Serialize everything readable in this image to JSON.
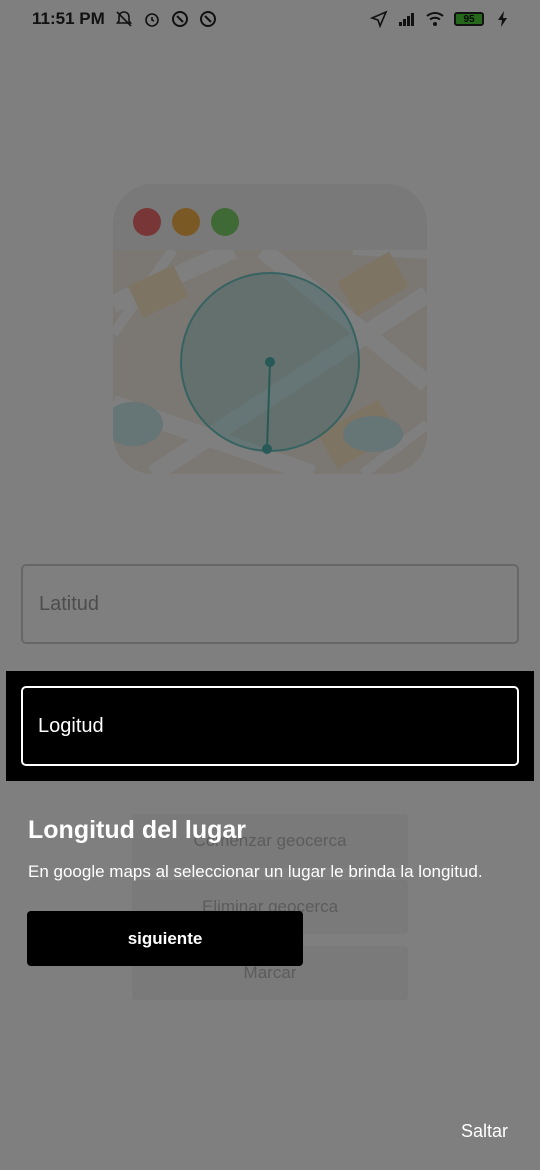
{
  "status_bar": {
    "time": "11:51 PM",
    "battery": "95",
    "icons": [
      "mute-bell-icon",
      "alarm-icon",
      "sync-icon",
      "sync-icon",
      "location-arrow-icon",
      "signal-icon",
      "wifi-icon",
      "battery-icon",
      "charging-icon"
    ]
  },
  "illustration": {
    "dot_colors": [
      "#f26d6d",
      "#f7b34b",
      "#7ed36b"
    ],
    "circle_color": "#6cc6c2"
  },
  "form": {
    "latitude_placeholder": "Latitud",
    "longitude_placeholder": "Logitud"
  },
  "buttons": {
    "start": "Comenzar geocerca",
    "delete": "Eliminar geocerca",
    "mark": "Marcar"
  },
  "tutorial": {
    "title": "Longitud del lugar",
    "description": "En google maps al seleccionar un lugar le brinda la longitud.",
    "next": "siguiente",
    "skip": "Saltar"
  }
}
